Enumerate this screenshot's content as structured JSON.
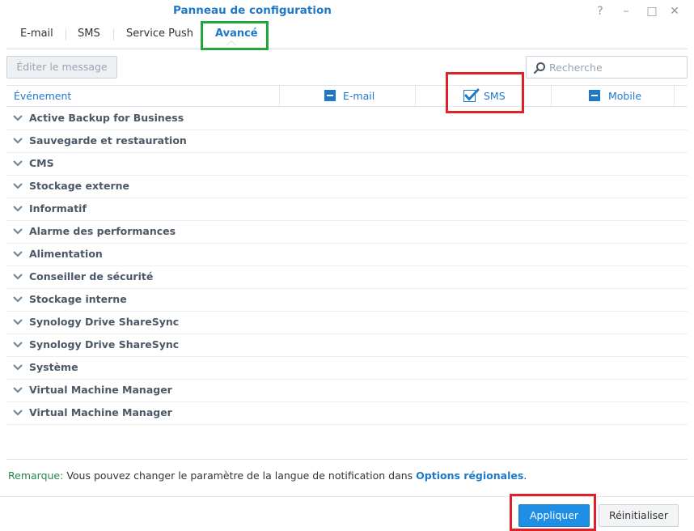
{
  "window": {
    "title": "Panneau de configuration",
    "help_glyph": "?",
    "minimize_glyph": "–",
    "maximize_glyph": "□",
    "close_glyph": "✕"
  },
  "tabs": [
    {
      "label": "E-mail",
      "active": false
    },
    {
      "label": "SMS",
      "active": false
    },
    {
      "label": "Service Push",
      "active": false
    },
    {
      "label": "Avancé",
      "active": true
    }
  ],
  "toolbar": {
    "edit_message_label": "Éditer le message",
    "search_placeholder": "Recherche"
  },
  "table": {
    "columns": {
      "event": "Événement",
      "email": "E-mail",
      "sms": "SMS",
      "mobile": "Mobile"
    },
    "column_states": {
      "email": "partial",
      "sms": "checked",
      "mobile": "partial"
    },
    "rows": [
      "Active Backup for Business",
      "Sauvegarde et restauration",
      "CMS",
      "Stockage externe",
      "Informatif",
      "Alarme des performances",
      "Alimentation",
      "Conseiller de sécurité",
      "Stockage interne",
      "Synology Drive ShareSync",
      "Synology Drive ShareSync",
      "Système",
      "Virtual Machine Manager",
      "Virtual Machine Manager"
    ]
  },
  "remark": {
    "label": "Remarque:",
    "text": " Vous pouvez changer le paramètre de la langue de notification dans ",
    "link": "Options régionales",
    "end": "."
  },
  "buttons": {
    "apply": "Appliquer",
    "reset": "Réinitialiser"
  },
  "colors": {
    "accent": "#1f79c8",
    "highlight_green": "#22a83a",
    "highlight_red": "#e0202a",
    "remark_label": "#23884b"
  }
}
